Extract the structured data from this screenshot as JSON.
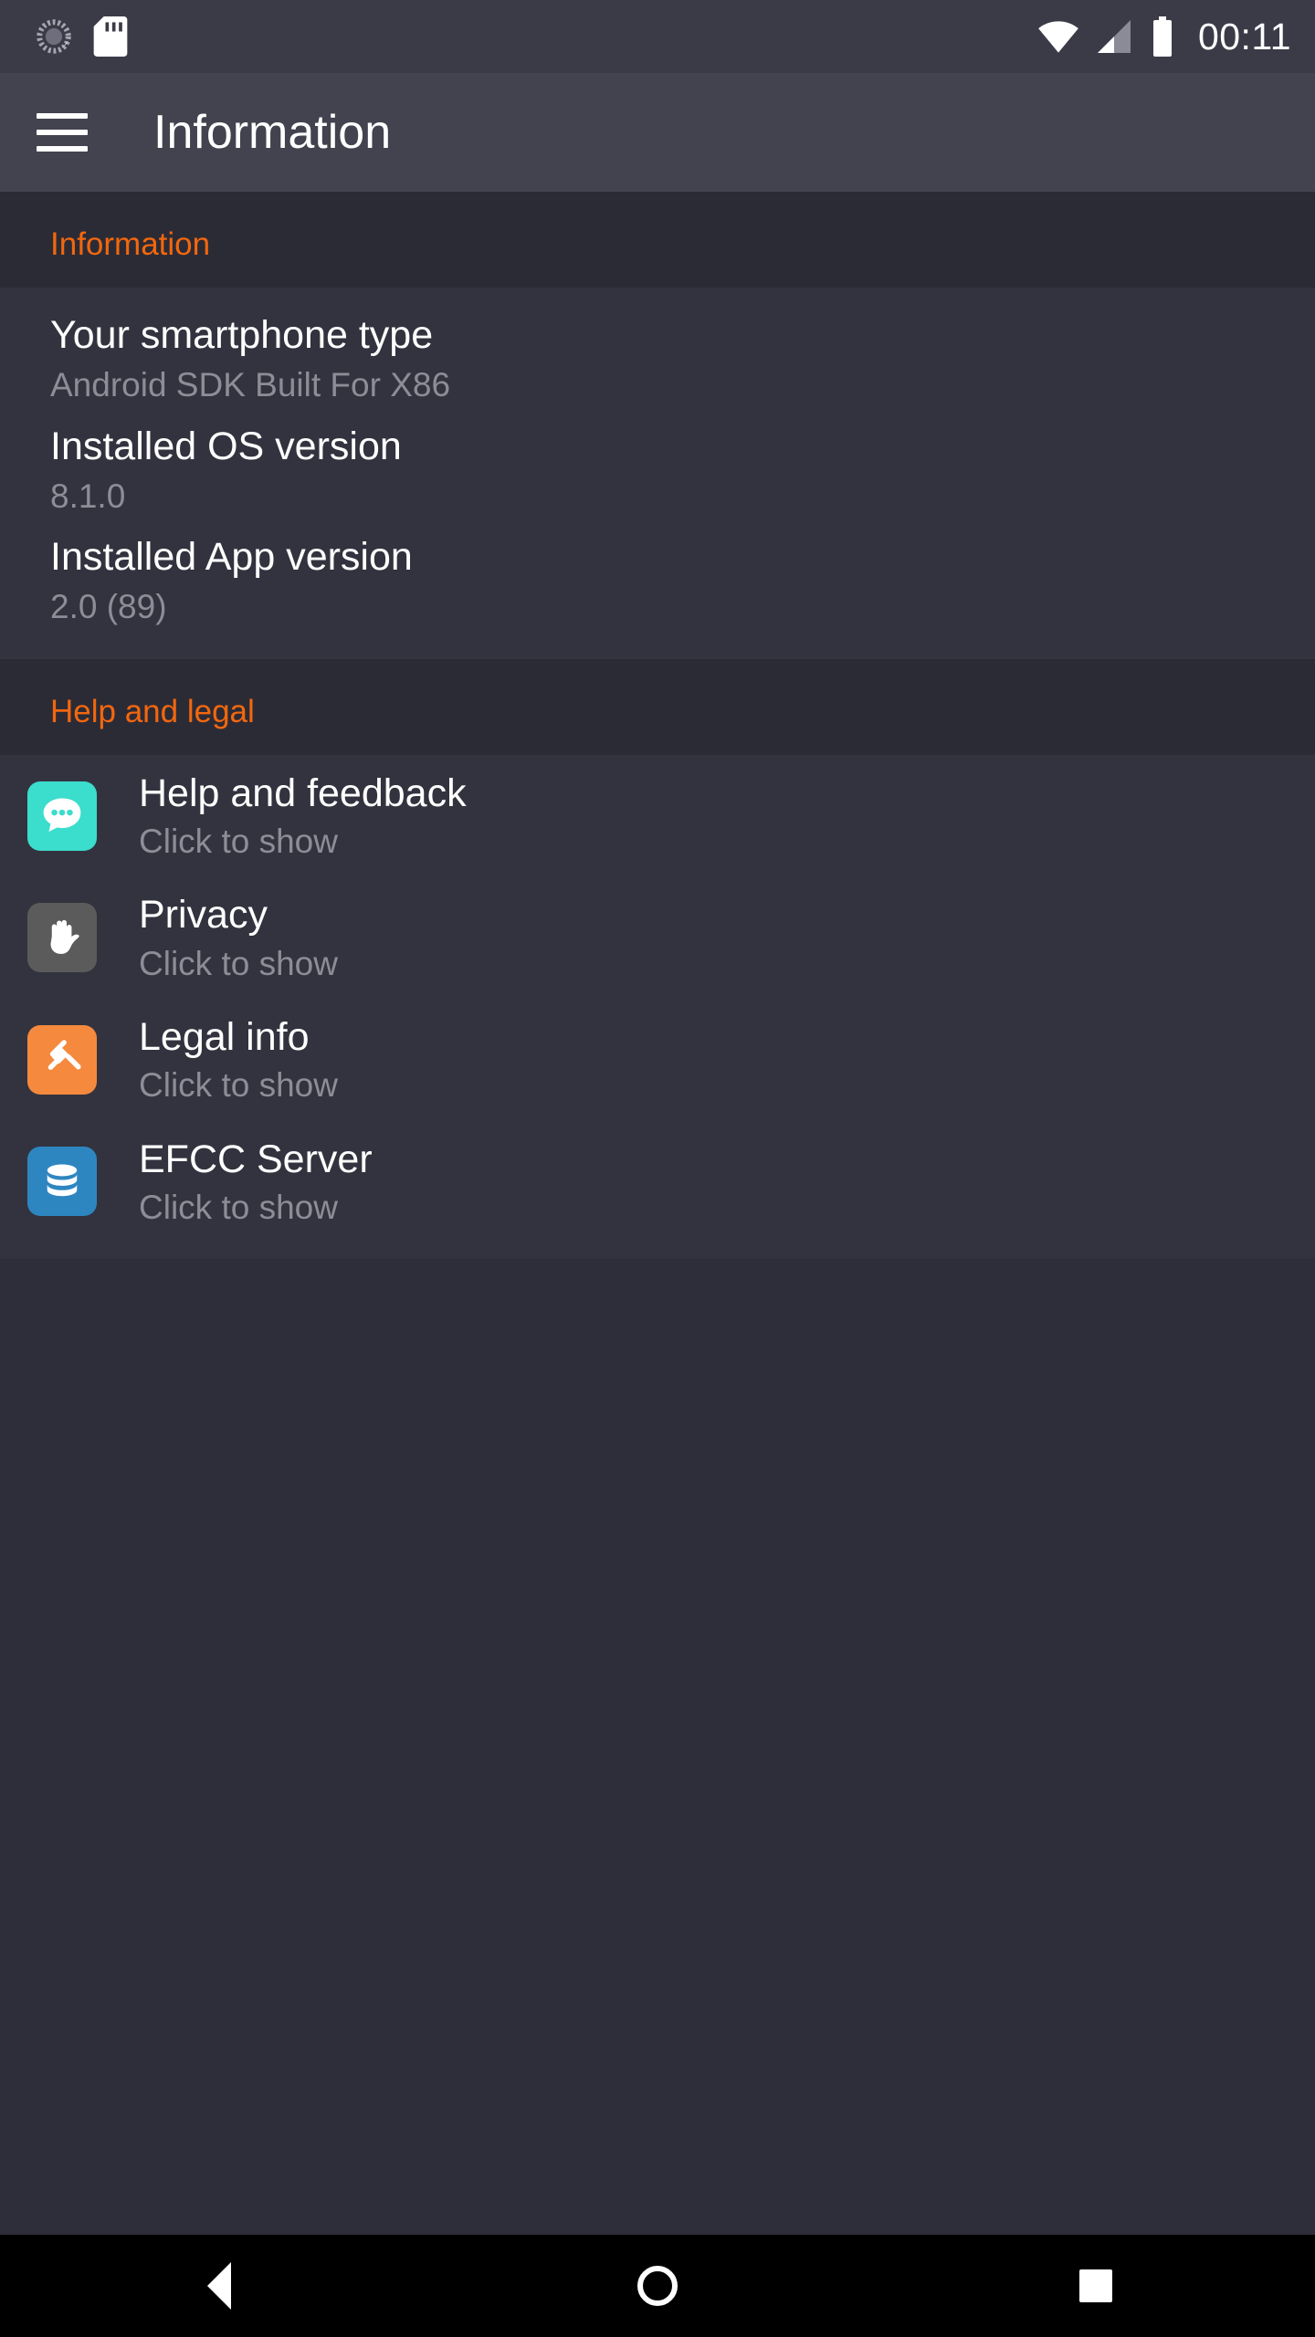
{
  "status_bar": {
    "icons_left": [
      "sync-icon",
      "sd-card-icon"
    ],
    "icons_right": [
      "wifi-icon",
      "cellular-signal-icon",
      "battery-icon"
    ],
    "clock": "00:11"
  },
  "app_bar": {
    "menu_icon": "hamburger-menu-icon",
    "title": "Information"
  },
  "sections": {
    "information": {
      "header": "Information",
      "items": [
        {
          "title": "Your smartphone type",
          "value": "Android SDK Built For X86"
        },
        {
          "title": "Installed OS version",
          "value": "8.1.0"
        },
        {
          "title": "Installed App version",
          "value": "2.0 (89)"
        }
      ]
    },
    "help_and_legal": {
      "header": "Help and legal",
      "items": [
        {
          "title": "Help and feedback",
          "subtitle": "Click to show",
          "icon": "chat-bubble-icon",
          "icon_color": "#3bddcc"
        },
        {
          "title": "Privacy",
          "subtitle": "Click to show",
          "icon": "hand-stop-icon",
          "icon_color": "#5b5b5b"
        },
        {
          "title": "Legal info",
          "subtitle": "Click to show",
          "icon": "gavel-icon",
          "icon_color": "#f5893d"
        },
        {
          "title": "EFCC Server",
          "subtitle": "Click to show",
          "icon": "database-icon",
          "icon_color": "#2e86c1"
        }
      ]
    }
  },
  "nav_bar": {
    "back": "back-triangle-icon",
    "home": "home-circle-icon",
    "recents": "recents-square-icon"
  },
  "colors": {
    "accent": "#f2670e",
    "status_bar_bg": "#3b3b48",
    "app_bar_bg": "#43434f",
    "page_bg": "#2e2e3a",
    "card_bg": "#33333f",
    "primary_text": "#ffffff",
    "secondary_text": "#8d8d97"
  }
}
